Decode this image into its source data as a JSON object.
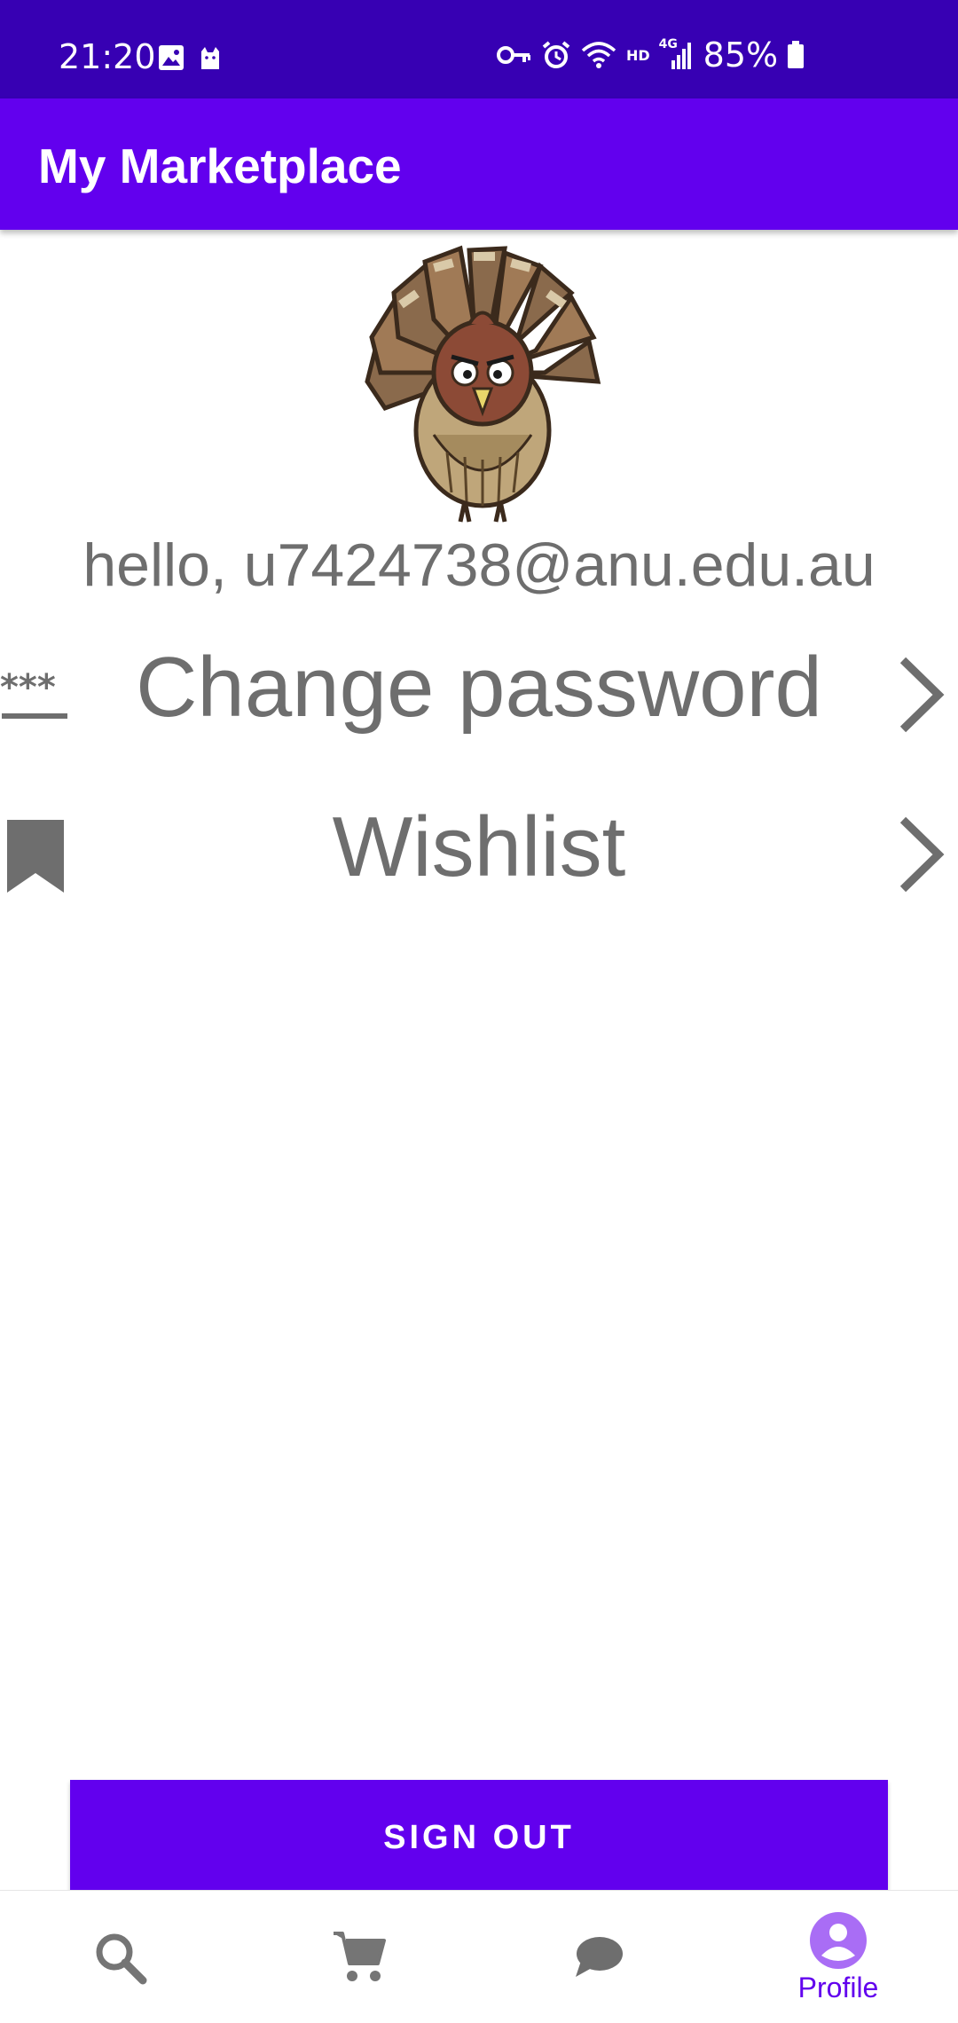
{
  "status_bar": {
    "time": "21:20",
    "battery_text": "85%",
    "hd_label": "HD",
    "network_label": "4G",
    "icons": [
      "image-icon",
      "cat-icon",
      "key-icon",
      "alarm-icon",
      "wifi-icon",
      "signal-icon",
      "battery-icon"
    ]
  },
  "app_bar": {
    "title": "My Marketplace"
  },
  "profile": {
    "greeting": "hello, u7424738@anu.edu.au",
    "avatar_icon": "turkey-avatar"
  },
  "menu": {
    "items": [
      {
        "label": "Change password",
        "icon": "password-icon"
      },
      {
        "label": "Wishlist",
        "icon": "bookmark-icon"
      }
    ]
  },
  "sign_out": {
    "label": "SIGN OUT"
  },
  "bottom_nav": {
    "items": [
      {
        "icon": "search-icon",
        "label": ""
      },
      {
        "icon": "cart-icon",
        "label": ""
      },
      {
        "icon": "chat-icon",
        "label": ""
      },
      {
        "icon": "profile-icon",
        "label": "Profile"
      }
    ],
    "active_index": 3
  },
  "colors": {
    "status_bar": "#3700b3",
    "primary": "#6200ee",
    "text_gray": "#6e6e6e",
    "inactive_icon": "#757575"
  }
}
